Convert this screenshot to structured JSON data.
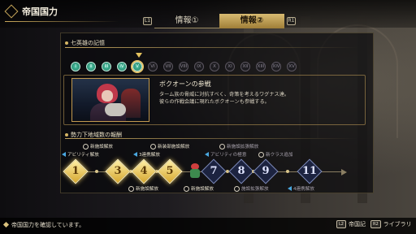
{
  "header": {
    "title": "帝国国力"
  },
  "tabs": {
    "left_key": "L1",
    "right_key": "R1",
    "items": [
      {
        "label": "情報①"
      },
      {
        "label": "情報②"
      }
    ],
    "active_index": 1
  },
  "heroes_section": {
    "title": "七英雄の記憶",
    "numerals": [
      "I",
      "II",
      "III",
      "IV",
      "V",
      "VI",
      "VII",
      "VIII",
      "IX",
      "X",
      "XI",
      "XII",
      "XIII",
      "XIV",
      "XV"
    ],
    "unlocked_count": 5,
    "current_index": 4
  },
  "event": {
    "title": "ボクオーンの参戦",
    "description_line1": "ターム族の脅威に対抗すべく、奇策を考えるワグナス達。",
    "description_line2": "彼らの作戦会議に現れたボクオーンも参戦する。"
  },
  "progress_section": {
    "title": "勢力下地域数の報酬",
    "labels_top": [
      {
        "text": "新施設解放",
        "icon": "facility-icon"
      },
      {
        "text": "アビリティ解放",
        "icon": "arrow-icon"
      },
      {
        "text": "新装部施設解放",
        "icon": "facility-icon"
      },
      {
        "text": "3連携解放",
        "icon": "arrow-icon"
      },
      {
        "text": "新施設拡張解放",
        "icon": "facility-icon"
      },
      {
        "text": "アビリティの極意",
        "icon": "arrow-icon"
      },
      {
        "text": "新クラス追加",
        "icon": "class-icon"
      }
    ],
    "labels_bottom": [
      {
        "text": "新施設解放",
        "icon": "facility-icon"
      },
      {
        "text": "新施設解放",
        "icon": "facility-icon"
      },
      {
        "text": "施設拡張解放",
        "icon": "facility-icon"
      },
      {
        "text": "4連携解放",
        "icon": "arrow-icon"
      }
    ],
    "stages": [
      {
        "num": "1",
        "done": true
      },
      {
        "num": "3",
        "done": true
      },
      {
        "num": "4",
        "done": true
      },
      {
        "num": "5",
        "done": true
      },
      {
        "num": "7",
        "done": false
      },
      {
        "num": "8",
        "done": false
      },
      {
        "num": "9",
        "done": false
      },
      {
        "num": "11",
        "done": false
      }
    ]
  },
  "footer": {
    "status": "帝国国力を確認しています。",
    "hint1_key": "L2",
    "hint1_label": "帝国記",
    "hint2_key": "R2",
    "hint2_label": "ライブラリ"
  },
  "colors": {
    "accent": "#d5b565",
    "unlocked": "#2fa384",
    "stage_done": "#e3b84a",
    "stage_pending": "#1c2340"
  }
}
